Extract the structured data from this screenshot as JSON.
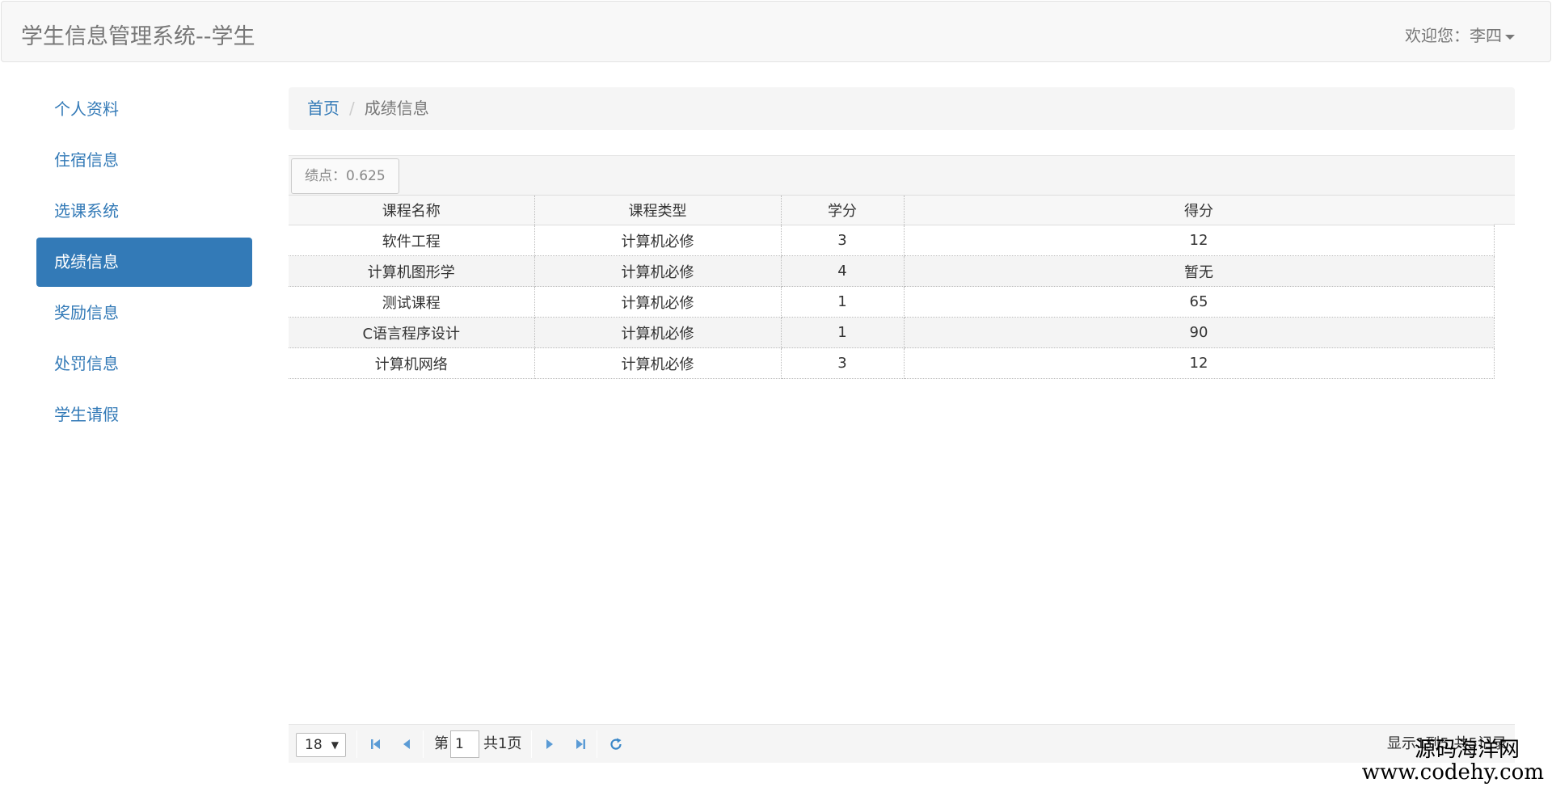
{
  "header": {
    "title": "学生信息管理系统--学生",
    "welcome": "欢迎您：李四"
  },
  "sidebar": {
    "items": [
      {
        "label": "个人资料"
      },
      {
        "label": "住宿信息"
      },
      {
        "label": "选课系统"
      },
      {
        "label": "成绩信息",
        "active": true
      },
      {
        "label": "奖励信息"
      },
      {
        "label": "处罚信息"
      },
      {
        "label": "学生请假"
      }
    ]
  },
  "breadcrumb": {
    "home": "首页",
    "current": "成绩信息"
  },
  "grid": {
    "gpa": "绩点：0.625",
    "columns": [
      "课程名称",
      "课程类型",
      "学分",
      "得分"
    ],
    "rows": [
      [
        "软件工程",
        "计算机必修",
        "3",
        "12"
      ],
      [
        "计算机图形学",
        "计算机必修",
        "4",
        "暂无"
      ],
      [
        "测试课程",
        "计算机必修",
        "1",
        "65"
      ],
      [
        "C语言程序设计",
        "计算机必修",
        "1",
        "90"
      ],
      [
        "计算机网络",
        "计算机必修",
        "3",
        "12"
      ]
    ]
  },
  "pager": {
    "page_size": "18",
    "page_prefix": "第",
    "page_value": "1",
    "page_total": "共1页",
    "info": "显示1到5,共5记录"
  },
  "watermark": {
    "line1": "源码海洋网",
    "line2": "www.codehy.com"
  },
  "colors": {
    "primary": "#337ab7",
    "pager_icon": "#5b9bd5"
  }
}
